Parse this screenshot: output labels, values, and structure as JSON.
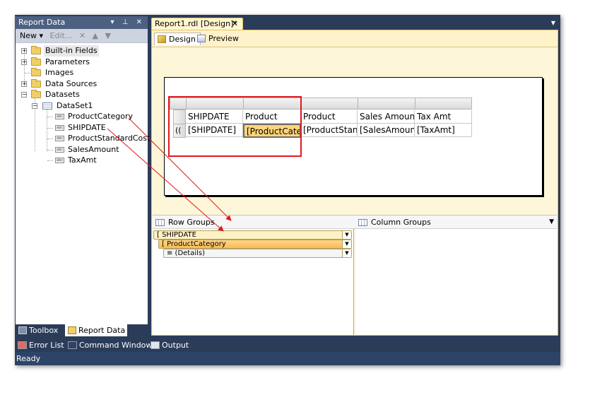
{
  "report_data_panel": {
    "title": "Report Data",
    "title_controls": "▾ ⊥ ✕",
    "toolbar": {
      "new_label": "New ▾",
      "edit_label": "Edit..."
    },
    "tree": {
      "builtin_fields": "Built-in Fields",
      "parameters": "Parameters",
      "images": "Images",
      "data_sources": "Data Sources",
      "datasets": "Datasets",
      "dataset1": "DataSet1",
      "fields": [
        "ProductCategory",
        "SHIPDATE",
        "ProductStandardCost",
        "SalesAmount",
        "TaxAmt"
      ]
    },
    "bottom_tabs": {
      "toolbox": "Toolbox",
      "report_data": "Report Data"
    }
  },
  "document": {
    "tab_title": "Report1.rdl [Design]*",
    "tab_close": "✕",
    "design_tab": "Design",
    "preview_tab": "Preview",
    "tablix": {
      "header_row": [
        "SHIPDATE",
        "Product",
        "Product",
        "Sales Amount",
        "Tax Amt"
      ],
      "detail_row": [
        "[SHIPDATE]",
        "[ProductCatego",
        "[ProductStanda",
        "[SalesAmount]",
        "[TaxAmt]"
      ],
      "group_indicator": "(("
    },
    "grouping": {
      "row_groups_label": "Row Groups",
      "column_groups_label": "Column Groups",
      "row_groups": [
        "[ SHIPDATE",
        "[ ProductCategory",
        "≡ (Details)"
      ]
    }
  },
  "output_tabs": [
    "Error List",
    "Command Window",
    "Output"
  ],
  "status_text": "Ready",
  "colors": {
    "frame_bg": "#2b3c59",
    "doc_tab_bg": "#fff7d1",
    "selected_group": "#ffbb4e",
    "annotation_red": "#e0191c"
  }
}
